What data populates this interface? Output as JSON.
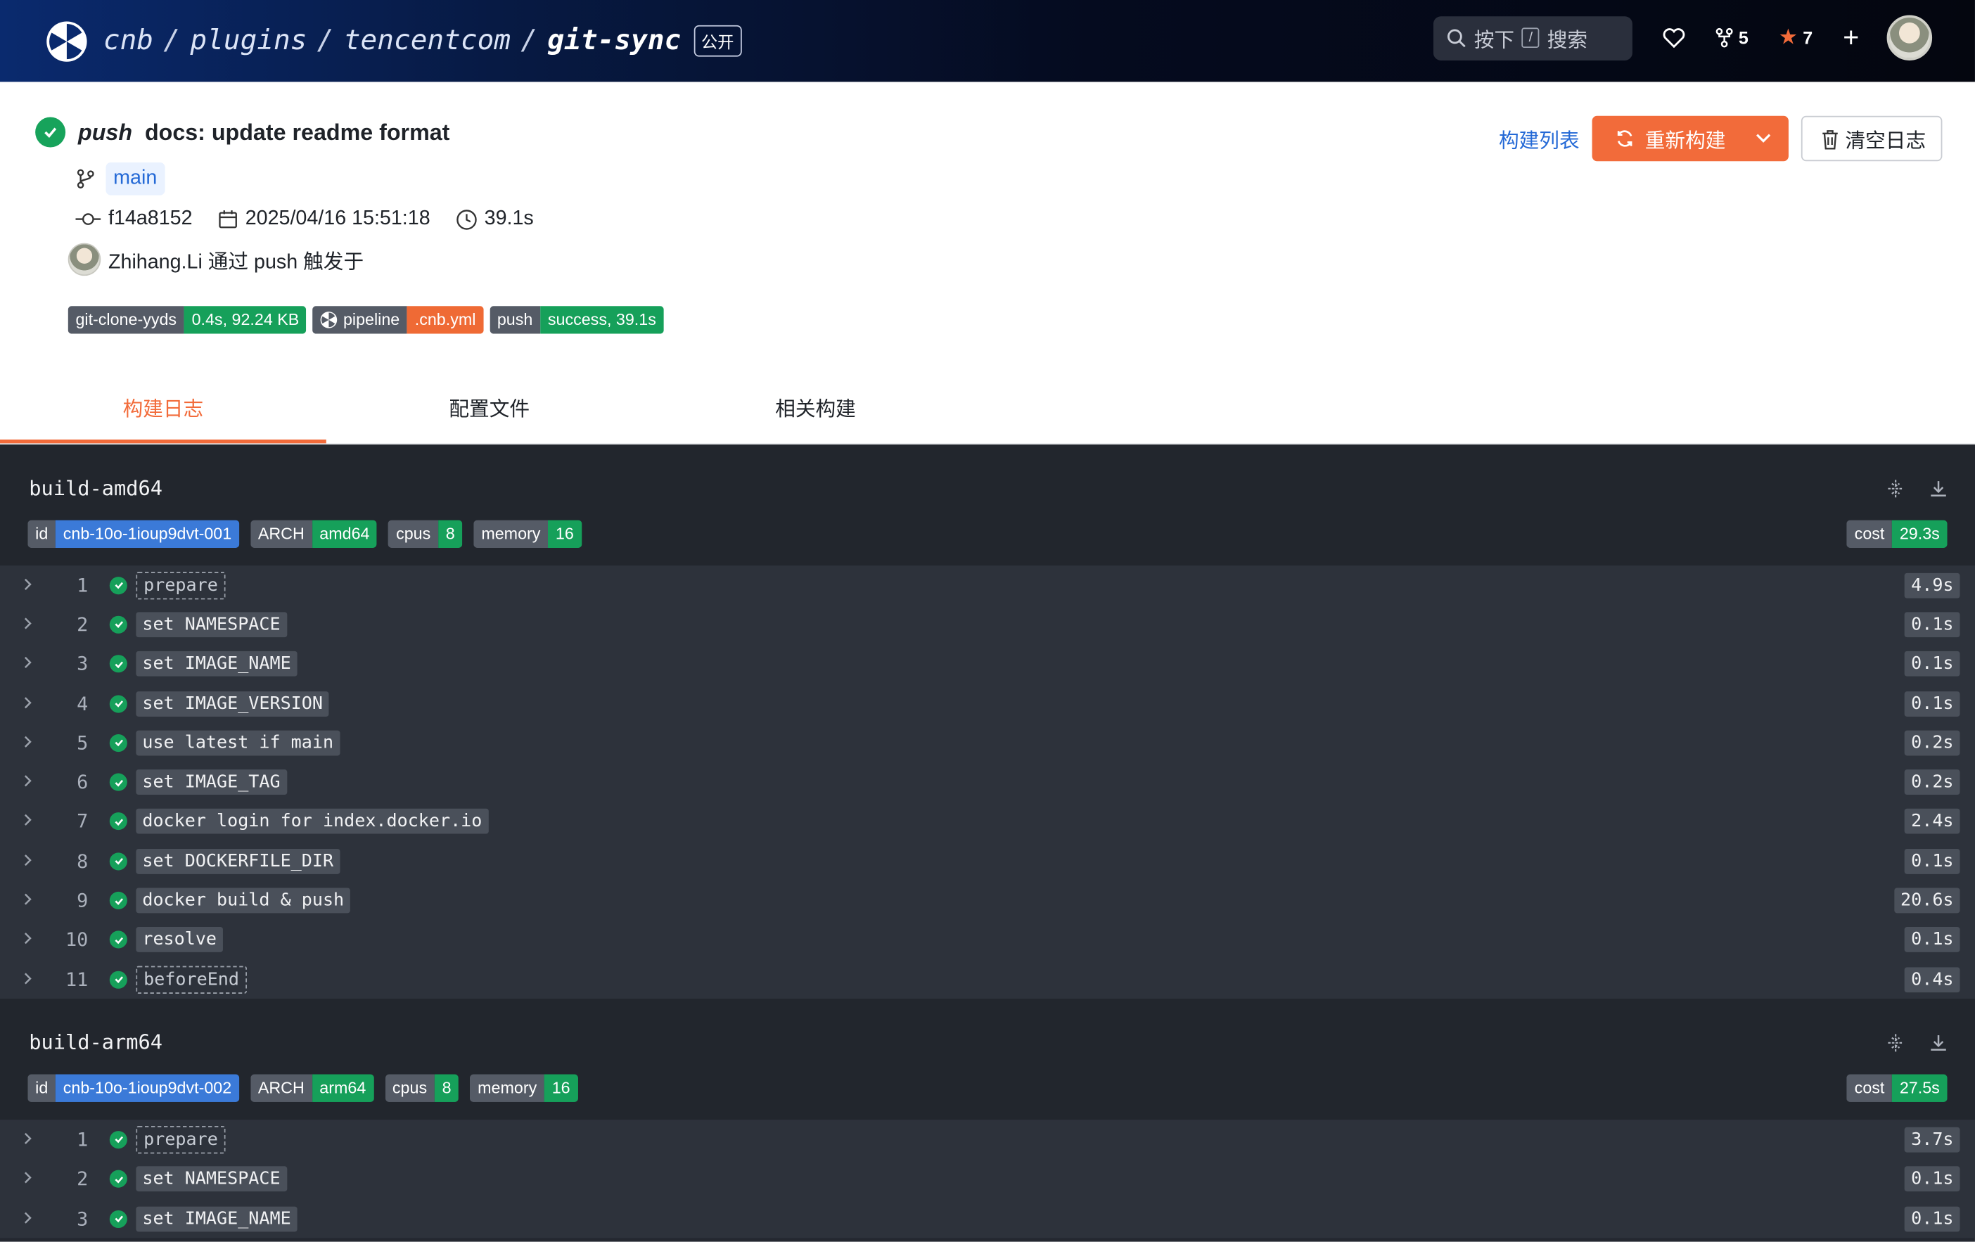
{
  "topbar": {
    "crumbs": [
      "cnb",
      "plugins",
      "tencentcom",
      "git-sync"
    ],
    "visibility": "公开",
    "search_label": "按下",
    "search_key": "/",
    "search_text": "搜索",
    "forks": "5",
    "stars": "7"
  },
  "build": {
    "event": "push",
    "message": "docs: update readme format",
    "branch": "main",
    "commit": "f14a8152",
    "date": "2025/04/16 15:51:18",
    "duration": "39.1s",
    "author_line": "Zhihang.Li 通过 push 触发于",
    "shields": [
      {
        "left": "git-clone-yyds",
        "right": "0.4s, 92.24 KB",
        "color": "#16a05a",
        "icon": false
      },
      {
        "left": "pipeline",
        "right": ".cnb.yml",
        "color": "#ef6a35",
        "icon": true
      },
      {
        "left": "push",
        "right": "success, 39.1s",
        "color": "#16a05a",
        "icon": false
      }
    ]
  },
  "actions": {
    "list": "构建列表",
    "rebuild": "重新构建",
    "clear": "清空日志"
  },
  "tabs": [
    "构建日志",
    "配置文件",
    "相关构建"
  ],
  "jobs": [
    {
      "title": "build-amd64",
      "tags": [
        {
          "k": "id",
          "v": "cnb-10o-1ioup9dvt-001",
          "c": "b"
        },
        {
          "k": "ARCH",
          "v": "amd64",
          "c": "g"
        },
        {
          "k": "cpus",
          "v": "8",
          "c": "g"
        },
        {
          "k": "memory",
          "v": "16",
          "c": "g"
        }
      ],
      "cost": {
        "k": "cost",
        "v": "29.3s"
      },
      "steps": [
        {
          "n": "1",
          "name": "prepare",
          "dur": "4.9s",
          "dashed": true
        },
        {
          "n": "2",
          "name": "set NAMESPACE",
          "dur": "0.1s"
        },
        {
          "n": "3",
          "name": "set IMAGE_NAME",
          "dur": "0.1s"
        },
        {
          "n": "4",
          "name": "set IMAGE_VERSION",
          "dur": "0.1s"
        },
        {
          "n": "5",
          "name": "use latest if main",
          "dur": "0.2s"
        },
        {
          "n": "6",
          "name": "set IMAGE_TAG",
          "dur": "0.2s"
        },
        {
          "n": "7",
          "name": "docker login for index.docker.io",
          "dur": "2.4s"
        },
        {
          "n": "8",
          "name": "set DOCKERFILE_DIR",
          "dur": "0.1s"
        },
        {
          "n": "9",
          "name": "docker build & push",
          "dur": "20.6s"
        },
        {
          "n": "10",
          "name": "resolve",
          "dur": "0.1s"
        },
        {
          "n": "11",
          "name": "beforeEnd",
          "dur": "0.4s",
          "dashed": true
        }
      ]
    },
    {
      "title": "build-arm64",
      "tags": [
        {
          "k": "id",
          "v": "cnb-10o-1ioup9dvt-002",
          "c": "b"
        },
        {
          "k": "ARCH",
          "v": "arm64",
          "c": "g"
        },
        {
          "k": "cpus",
          "v": "8",
          "c": "g"
        },
        {
          "k": "memory",
          "v": "16",
          "c": "g"
        }
      ],
      "cost": {
        "k": "cost",
        "v": "27.5s"
      },
      "steps": [
        {
          "n": "1",
          "name": "prepare",
          "dur": "3.7s",
          "dashed": true
        },
        {
          "n": "2",
          "name": "set NAMESPACE",
          "dur": "0.1s"
        },
        {
          "n": "3",
          "name": "set IMAGE_NAME",
          "dur": "0.1s"
        }
      ]
    }
  ]
}
